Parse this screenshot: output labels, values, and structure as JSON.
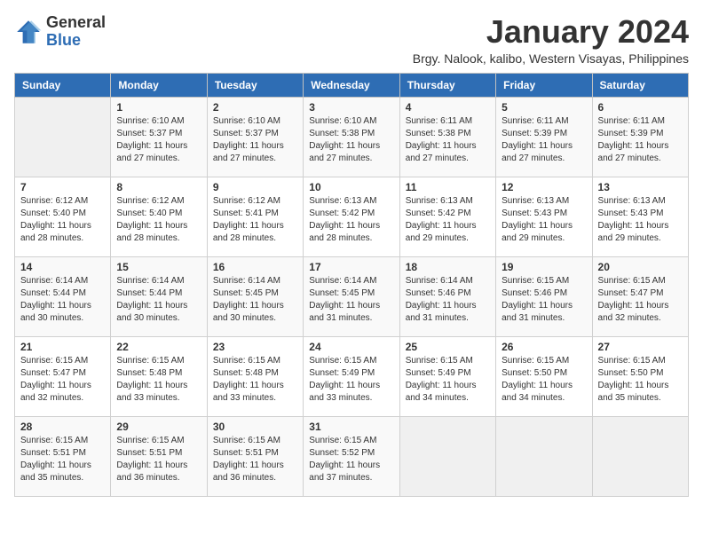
{
  "logo": {
    "general": "General",
    "blue": "Blue"
  },
  "title": "January 2024",
  "location": "Brgy. Nalook, kalibo, Western Visayas, Philippines",
  "days_of_week": [
    "Sunday",
    "Monday",
    "Tuesday",
    "Wednesday",
    "Thursday",
    "Friday",
    "Saturday"
  ],
  "weeks": [
    [
      {
        "day": "",
        "info": ""
      },
      {
        "day": "1",
        "info": "Sunrise: 6:10 AM\nSunset: 5:37 PM\nDaylight: 11 hours and 27 minutes."
      },
      {
        "day": "2",
        "info": "Sunrise: 6:10 AM\nSunset: 5:37 PM\nDaylight: 11 hours and 27 minutes."
      },
      {
        "day": "3",
        "info": "Sunrise: 6:10 AM\nSunset: 5:38 PM\nDaylight: 11 hours and 27 minutes."
      },
      {
        "day": "4",
        "info": "Sunrise: 6:11 AM\nSunset: 5:38 PM\nDaylight: 11 hours and 27 minutes."
      },
      {
        "day": "5",
        "info": "Sunrise: 6:11 AM\nSunset: 5:39 PM\nDaylight: 11 hours and 27 minutes."
      },
      {
        "day": "6",
        "info": "Sunrise: 6:11 AM\nSunset: 5:39 PM\nDaylight: 11 hours and 27 minutes."
      }
    ],
    [
      {
        "day": "7",
        "info": "Sunrise: 6:12 AM\nSunset: 5:40 PM\nDaylight: 11 hours and 28 minutes."
      },
      {
        "day": "8",
        "info": "Sunrise: 6:12 AM\nSunset: 5:40 PM\nDaylight: 11 hours and 28 minutes."
      },
      {
        "day": "9",
        "info": "Sunrise: 6:12 AM\nSunset: 5:41 PM\nDaylight: 11 hours and 28 minutes."
      },
      {
        "day": "10",
        "info": "Sunrise: 6:13 AM\nSunset: 5:42 PM\nDaylight: 11 hours and 28 minutes."
      },
      {
        "day": "11",
        "info": "Sunrise: 6:13 AM\nSunset: 5:42 PM\nDaylight: 11 hours and 29 minutes."
      },
      {
        "day": "12",
        "info": "Sunrise: 6:13 AM\nSunset: 5:43 PM\nDaylight: 11 hours and 29 minutes."
      },
      {
        "day": "13",
        "info": "Sunrise: 6:13 AM\nSunset: 5:43 PM\nDaylight: 11 hours and 29 minutes."
      }
    ],
    [
      {
        "day": "14",
        "info": "Sunrise: 6:14 AM\nSunset: 5:44 PM\nDaylight: 11 hours and 30 minutes."
      },
      {
        "day": "15",
        "info": "Sunrise: 6:14 AM\nSunset: 5:44 PM\nDaylight: 11 hours and 30 minutes."
      },
      {
        "day": "16",
        "info": "Sunrise: 6:14 AM\nSunset: 5:45 PM\nDaylight: 11 hours and 30 minutes."
      },
      {
        "day": "17",
        "info": "Sunrise: 6:14 AM\nSunset: 5:45 PM\nDaylight: 11 hours and 31 minutes."
      },
      {
        "day": "18",
        "info": "Sunrise: 6:14 AM\nSunset: 5:46 PM\nDaylight: 11 hours and 31 minutes."
      },
      {
        "day": "19",
        "info": "Sunrise: 6:15 AM\nSunset: 5:46 PM\nDaylight: 11 hours and 31 minutes."
      },
      {
        "day": "20",
        "info": "Sunrise: 6:15 AM\nSunset: 5:47 PM\nDaylight: 11 hours and 32 minutes."
      }
    ],
    [
      {
        "day": "21",
        "info": "Sunrise: 6:15 AM\nSunset: 5:47 PM\nDaylight: 11 hours and 32 minutes."
      },
      {
        "day": "22",
        "info": "Sunrise: 6:15 AM\nSunset: 5:48 PM\nDaylight: 11 hours and 33 minutes."
      },
      {
        "day": "23",
        "info": "Sunrise: 6:15 AM\nSunset: 5:48 PM\nDaylight: 11 hours and 33 minutes."
      },
      {
        "day": "24",
        "info": "Sunrise: 6:15 AM\nSunset: 5:49 PM\nDaylight: 11 hours and 33 minutes."
      },
      {
        "day": "25",
        "info": "Sunrise: 6:15 AM\nSunset: 5:49 PM\nDaylight: 11 hours and 34 minutes."
      },
      {
        "day": "26",
        "info": "Sunrise: 6:15 AM\nSunset: 5:50 PM\nDaylight: 11 hours and 34 minutes."
      },
      {
        "day": "27",
        "info": "Sunrise: 6:15 AM\nSunset: 5:50 PM\nDaylight: 11 hours and 35 minutes."
      }
    ],
    [
      {
        "day": "28",
        "info": "Sunrise: 6:15 AM\nSunset: 5:51 PM\nDaylight: 11 hours and 35 minutes."
      },
      {
        "day": "29",
        "info": "Sunrise: 6:15 AM\nSunset: 5:51 PM\nDaylight: 11 hours and 36 minutes."
      },
      {
        "day": "30",
        "info": "Sunrise: 6:15 AM\nSunset: 5:51 PM\nDaylight: 11 hours and 36 minutes."
      },
      {
        "day": "31",
        "info": "Sunrise: 6:15 AM\nSunset: 5:52 PM\nDaylight: 11 hours and 37 minutes."
      },
      {
        "day": "",
        "info": ""
      },
      {
        "day": "",
        "info": ""
      },
      {
        "day": "",
        "info": ""
      }
    ]
  ]
}
